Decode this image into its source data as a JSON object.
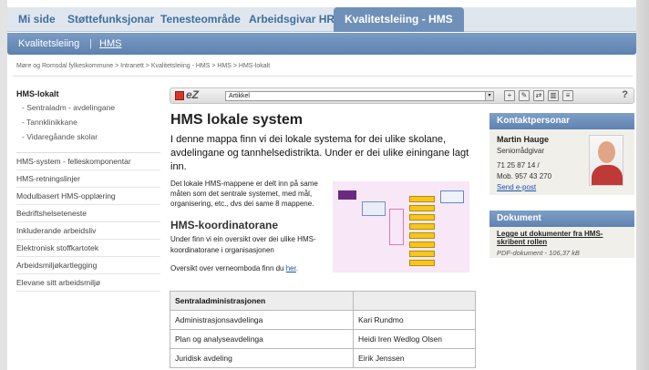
{
  "topnav": {
    "tabs": [
      "Mi side",
      "Støttefunksjonar",
      "Tenesteområde",
      "Arbeidsgivar HR",
      "Kvalitetsleiing - HMS"
    ]
  },
  "subnav": {
    "items": [
      "Kvalitetsleiing",
      "|",
      "HMS"
    ]
  },
  "breadcrumb": "Møre og Romsdal fylkeskommune > Intranett > Kvalitetsleiing - HMS > HMS > HMS-lokalt",
  "left_menu": {
    "title": "HMS-lokalt",
    "subitems": [
      "Sentraladm - avdelingane",
      "Tannklinikkane",
      "Vidaregåande skolar"
    ],
    "items": [
      "HMS-system - felleskomponentar",
      "HMS-retningslinjer",
      "Modulbasert HMS-opplæring",
      "Bedriftshelseteneste",
      "Inkluderande arbeidsliv",
      "Elektronisk stoffkartotek",
      "Arbeidsmiljøkartlegging",
      "Elevane sitt arbeidsmiljø"
    ]
  },
  "toolbar": {
    "logo_text": "eZ",
    "select_value": "Artikkel",
    "help": "?"
  },
  "main": {
    "title": "HMS lokale system",
    "lead": "I denne mappa finn vi dei lokale systema for dei ulike skolane, avdelingane og tannhelsedistrikta. Under er dei ulike einingane lagt inn.",
    "para1": "Det lokale HMS-mappene er delt inn på same måten som det sentrale systemet, med mål, organisering, etc., dvs dei same 8 mappene.",
    "h2": "HMS-koordinatorane",
    "para2": "Under finn vi ein oversikt over dei ulike HMS-koordinatorane i organisasjonen",
    "para3_prefix": "Oversikt over verneomboda finn du ",
    "para3_link": "her",
    "para3_suffix": "."
  },
  "table": {
    "header": [
      "Sentraladministrasjonen",
      ""
    ],
    "rows": [
      [
        "Administrasjonsavdelinga",
        "Kari Rundmo"
      ],
      [
        "Plan og analyseavdelinga",
        "Heidi Iren Wedlog Olsen"
      ],
      [
        "Juridisk avdeling",
        "Eirik Jenssen"
      ]
    ]
  },
  "contact": {
    "header": "Kontaktpersonar",
    "name": "Martin Hauge",
    "role": "Seniorrådgivar",
    "phone1": "71 25 87 14 /",
    "phone2": "Mob. 957 43 270",
    "email_link": "Send e-post"
  },
  "document": {
    "header": "Dokument",
    "link": "Legge ut dokumenter fra HMS-skribent rollen",
    "meta": "PDF-dokument - 106,37 kB"
  },
  "colors": {
    "accent": "#6f90b8",
    "link": "#1a50a8",
    "tab_text": "#3f6f9e"
  }
}
